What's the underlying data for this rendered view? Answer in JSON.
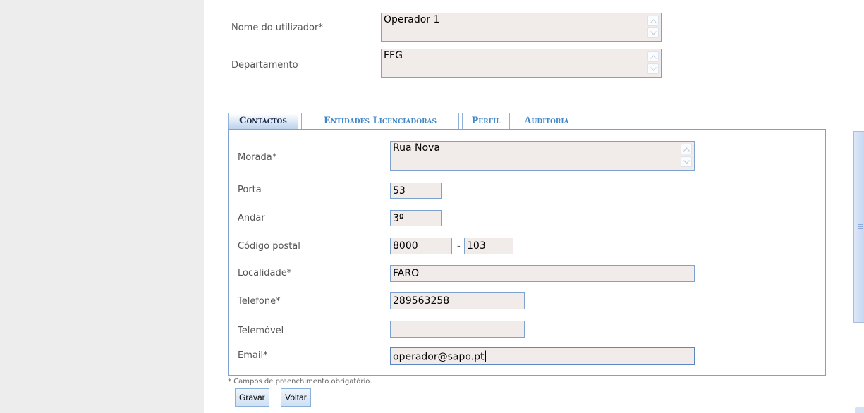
{
  "header_fields": {
    "nome": {
      "label": "Nome do utilizador*",
      "value": "Operador 1"
    },
    "departamento": {
      "label": "Departamento",
      "value": "FFG"
    }
  },
  "tabs": [
    {
      "label": "Contactos",
      "active": true
    },
    {
      "label": "Entidades Licenciadoras",
      "active": false
    },
    {
      "label": "Perfil",
      "active": false
    },
    {
      "label": "Auditoria",
      "active": false
    }
  ],
  "contactos": {
    "morada": {
      "label": "Morada*",
      "value": "Rua Nova"
    },
    "porta": {
      "label": "Porta",
      "value": "53"
    },
    "andar": {
      "label": "Andar",
      "value": "3º"
    },
    "codigo_postal": {
      "label": "Código postal",
      "value_1": "8000",
      "separator": "-",
      "value_2": "103"
    },
    "localidade": {
      "label": "Localidade*",
      "value": "FARO"
    },
    "telefone": {
      "label": "Telefone*",
      "value": "289563258"
    },
    "telemovel": {
      "label": "Telemóvel",
      "value": ""
    },
    "email": {
      "label": "Email*",
      "value": "operador@sapo.pt"
    }
  },
  "footnote": "* Campos de preenchimento obrigatório.",
  "buttons": {
    "gravar": "Gravar",
    "voltar": "Voltar"
  },
  "colors": {
    "field_bg": "#f1ece9",
    "field_border": "#7da2ce",
    "tab_text": "#3f86c6",
    "left_panel": "#ededed"
  },
  "icons": {
    "spinner_up": "chevron-up-icon",
    "spinner_down": "chevron-down-icon"
  }
}
